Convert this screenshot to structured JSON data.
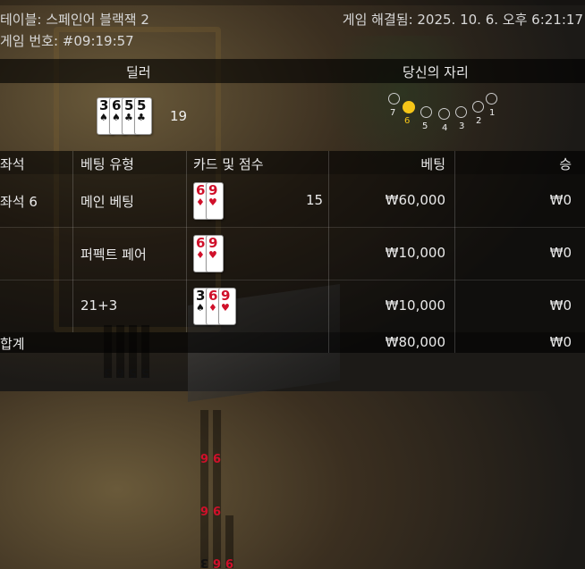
{
  "header": {
    "table_label": "테이블: 스페인어 블랙잭 2",
    "game_number_label": "게임 번호: #09:19:57",
    "resolved_label": "게임 해결됨: 2025. 10. 6. 오후 6:21:17"
  },
  "dealer": {
    "title": "딜러",
    "cards": [
      {
        "rank": "3",
        "suit": "♠"
      },
      {
        "rank": "6",
        "suit": "♠"
      },
      {
        "rank": "5",
        "suit": "♣"
      },
      {
        "rank": "5",
        "suit": "♣"
      }
    ],
    "score": "19"
  },
  "seat_panel": {
    "title": "당신의 자리",
    "seats": [
      "7",
      "6",
      "5",
      "4",
      "3",
      "2",
      "1"
    ],
    "my_seat": "6"
  },
  "table": {
    "headers": {
      "seat": "좌석",
      "bet_type": "베팅 유형",
      "cards": "카드 및 점수",
      "bet": "베팅",
      "win": "승"
    },
    "rows": [
      {
        "seat": "좌석 6",
        "bet_type": "메인 베팅",
        "cards": [
          {
            "rank": "6",
            "suit": "♦"
          },
          {
            "rank": "9",
            "suit": "♥"
          }
        ],
        "score": "15",
        "bet": "₩60,000",
        "win": "₩0"
      },
      {
        "seat": "",
        "bet_type": "퍼펙트 페어",
        "cards": [
          {
            "rank": "6",
            "suit": "♦"
          },
          {
            "rank": "9",
            "suit": "♥"
          }
        ],
        "score": "",
        "bet": "₩10,000",
        "win": "₩0"
      },
      {
        "seat": "",
        "bet_type": "21+3",
        "cards": [
          {
            "rank": "3",
            "suit": "♠"
          },
          {
            "rank": "6",
            "suit": "♦"
          },
          {
            "rank": "9",
            "suit": "♥"
          }
        ],
        "score": "",
        "bet": "₩10,000",
        "win": "₩0"
      }
    ],
    "total": {
      "label": "합계",
      "bet": "₩80,000",
      "win": "₩0"
    }
  },
  "colors": {
    "my_seat_accent": "#f5c518",
    "red_suit": "#d0102a"
  }
}
